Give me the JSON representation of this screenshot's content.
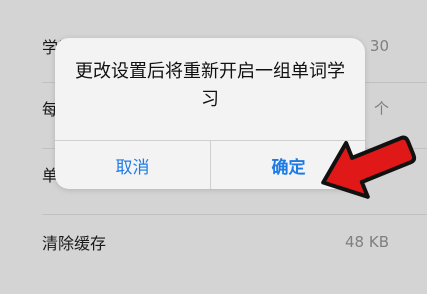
{
  "settings": {
    "rows": [
      {
        "label": "学习设置",
        "value": "30"
      },
      {
        "label": "每",
        "value": "个"
      },
      {
        "label": "单",
        "value": ""
      },
      {
        "label": "清除缓存",
        "value": "48 KB"
      }
    ]
  },
  "dialog": {
    "message": "更改设置后将重新开启一组单词学习",
    "cancel_label": "取消",
    "confirm_label": "确定"
  },
  "colors": {
    "accent": "#1e7be6",
    "arrow": "#e01818"
  }
}
